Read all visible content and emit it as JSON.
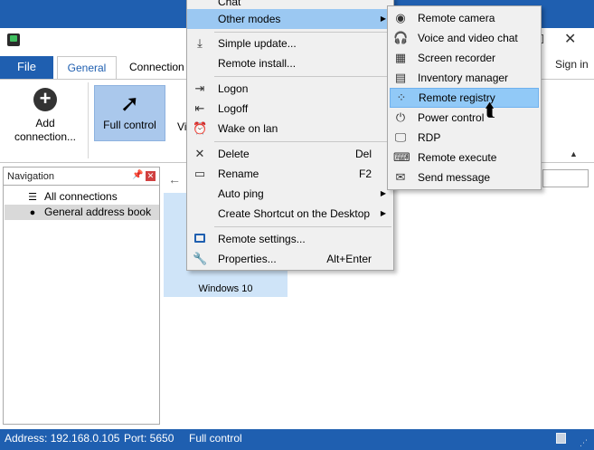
{
  "window": {
    "sign_in": "Sign in"
  },
  "tabs": {
    "file": "File",
    "general": "General",
    "connection": "Connection"
  },
  "ribbon": {
    "add_connection": "Add connection...",
    "full_control": "Full control",
    "partial_label": "Vi"
  },
  "navigation": {
    "title": "Navigation",
    "items": [
      {
        "label": "All connections",
        "icon": "list-icon"
      },
      {
        "label": "General address book",
        "icon": "bullet-icon"
      }
    ]
  },
  "content": {
    "tile_label": "Windows 10"
  },
  "context_menu": {
    "top_partial": "Chat",
    "items": [
      {
        "label": "Other modes",
        "icon": "",
        "has_submenu": true,
        "highlighted": true
      },
      {
        "label": "Simple update...",
        "icon": "download-icon"
      },
      {
        "label": "Remote install...",
        "icon": ""
      },
      {
        "label": "Logon",
        "icon": "logon-icon"
      },
      {
        "label": "Logoff",
        "icon": "logoff-icon"
      },
      {
        "label": "Wake on lan",
        "icon": "alarm-clock-icon"
      },
      {
        "label": "Delete",
        "icon": "delete-x-icon",
        "shortcut": "Del"
      },
      {
        "label": "Rename",
        "icon": "rename-icon",
        "shortcut": "F2"
      },
      {
        "label": "Auto ping",
        "icon": "",
        "has_submenu": true
      },
      {
        "label": "Create Shortcut on the Desktop",
        "icon": "",
        "has_submenu": true
      },
      {
        "label": "Remote settings...",
        "icon": "remote-settings-icon"
      },
      {
        "label": "Properties...",
        "icon": "wrench-icon",
        "shortcut": "Alt+Enter"
      }
    ]
  },
  "submenu": {
    "items": [
      {
        "label": "Remote camera",
        "icon": "camera-icon"
      },
      {
        "label": "Voice and video chat",
        "icon": "headset-icon"
      },
      {
        "label": "Screen recorder",
        "icon": "film-icon"
      },
      {
        "label": "Inventory manager",
        "icon": "inventory-icon"
      },
      {
        "label": "Remote registry",
        "icon": "registry-icon",
        "highlighted": true
      },
      {
        "label": "Power control",
        "icon": "power-icon"
      },
      {
        "label": "RDP",
        "icon": "monitor-icon"
      },
      {
        "label": "Remote execute",
        "icon": "keyboard-icon"
      },
      {
        "label": "Send message",
        "icon": "envelope-icon"
      }
    ]
  },
  "status": {
    "address": "Address: 192.168.0.105",
    "port": "Port: 5650",
    "mode": "Full control"
  },
  "colors": {
    "accent": "#1f5fb0",
    "highlight": "#91c9f7",
    "tile": "#cfe4f8"
  }
}
